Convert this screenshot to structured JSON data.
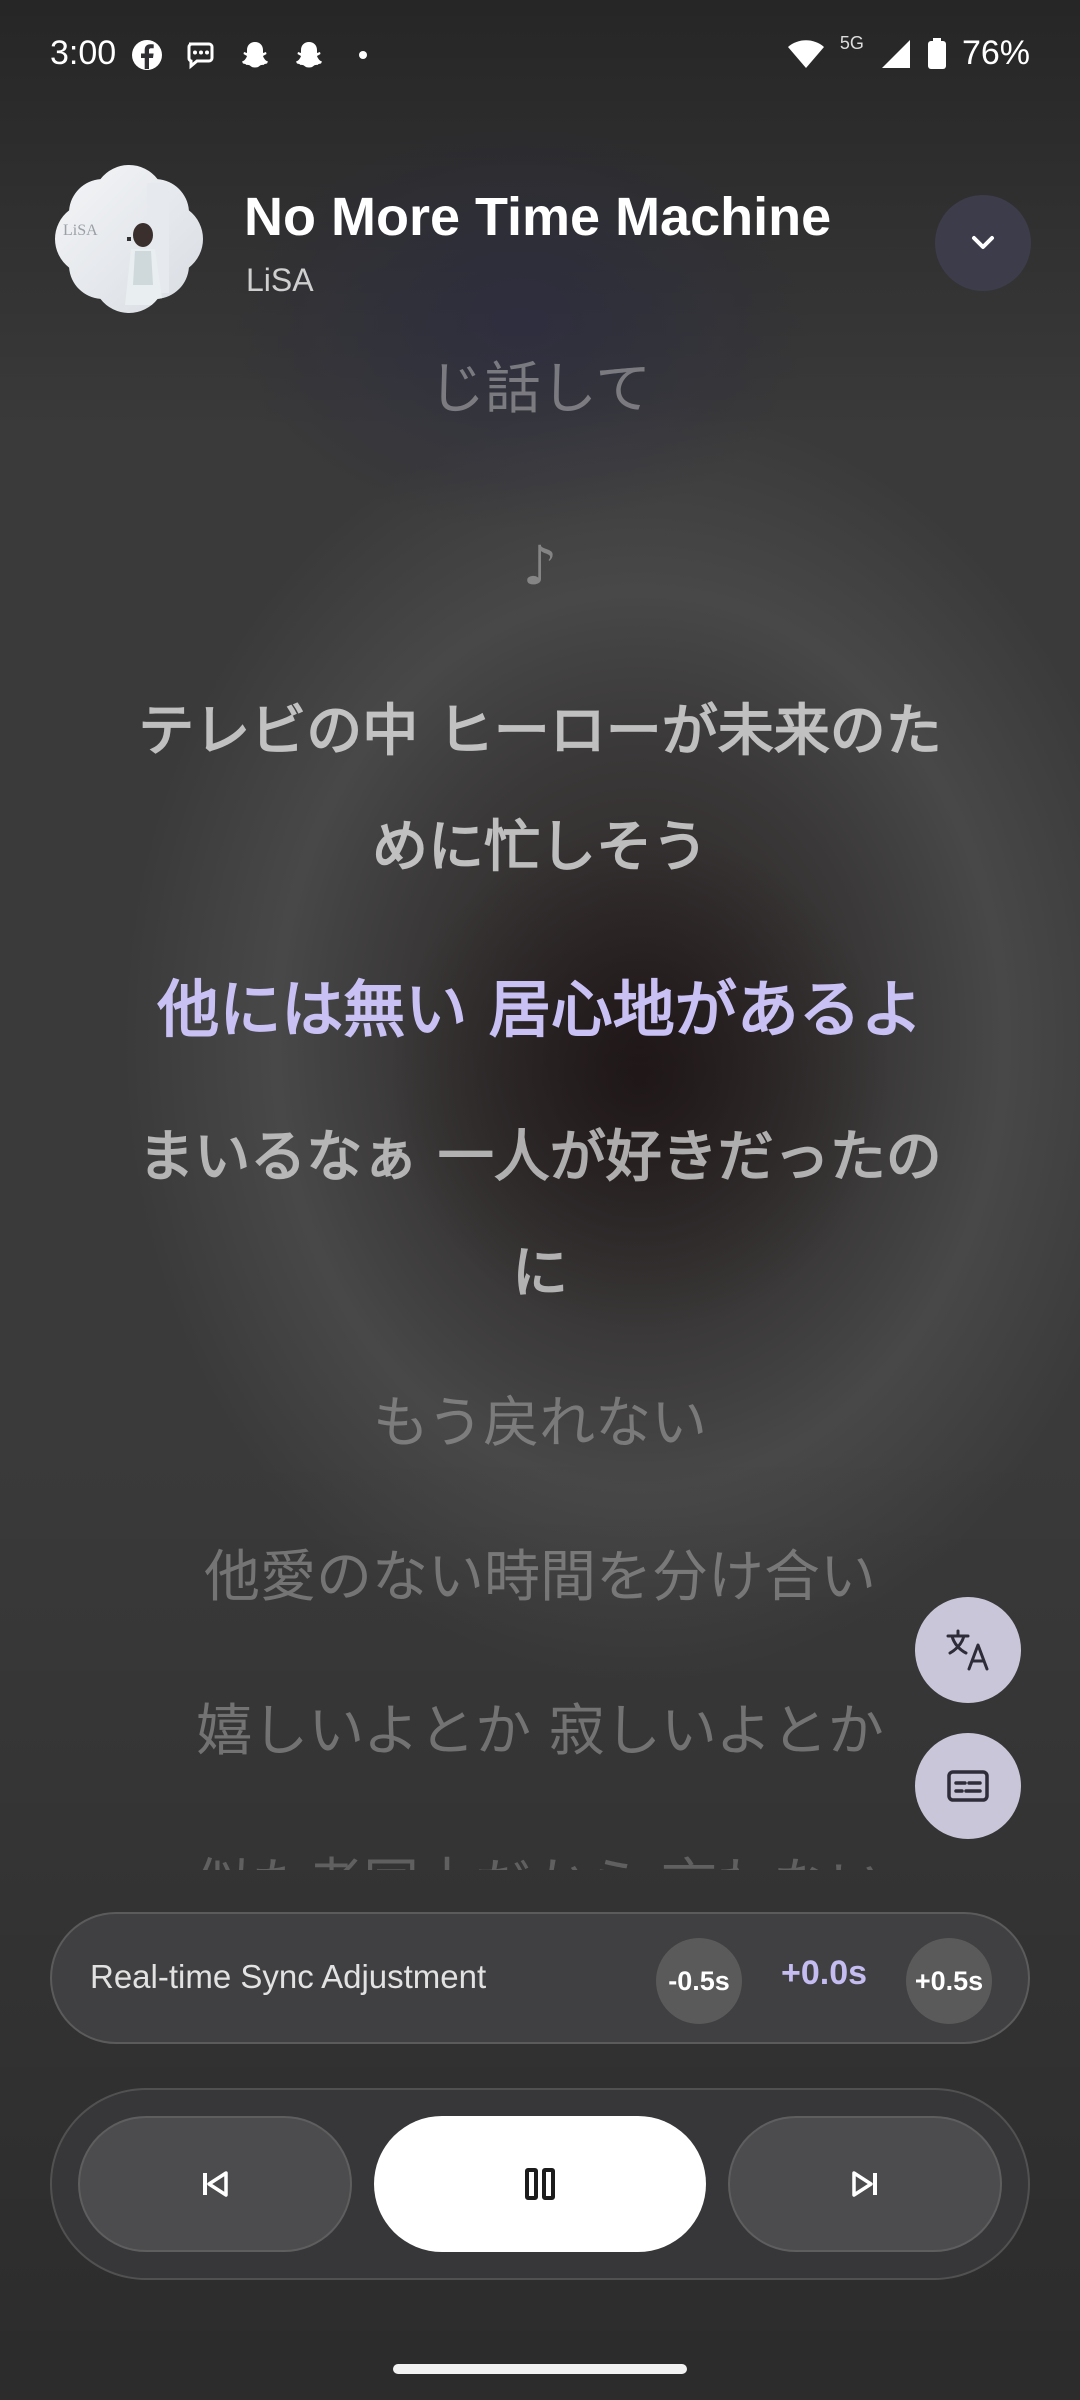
{
  "status_bar": {
    "time": "3:00",
    "left_icons": [
      "facebook-icon",
      "messenger-icon",
      "snapchat-icon",
      "snapchat-icon",
      "dot-icon"
    ],
    "network_label": "5G",
    "battery": "76%"
  },
  "track": {
    "title": "No More Time Machine",
    "artist": "LiSA",
    "album_art_text": "LiSA"
  },
  "lyrics": [
    {
      "text": "じ話して",
      "state": "faded"
    },
    {
      "text": "♪",
      "state": "faded"
    },
    {
      "text": "テレビの中 ヒーローが未来のた",
      "state": "near"
    },
    {
      "text": "めに忙しそう",
      "state": "near"
    },
    {
      "text": "他には無い 居心地があるよ",
      "state": "active"
    },
    {
      "text": "まいるなぁ 一人が好きだったの",
      "state": "next"
    },
    {
      "text": "に",
      "state": "next"
    },
    {
      "text": "もう戻れない",
      "state": "dim"
    },
    {
      "text": "他愛のない時間を分け合い",
      "state": "dim"
    },
    {
      "text": "嬉しいよとか 寂しいよとか",
      "state": "dim"
    },
    {
      "text": "似た者同士だから 言わない",
      "state": "cut"
    }
  ],
  "fabs": {
    "translate_icon": "translate-icon",
    "subtitles_icon": "subtitles-icon"
  },
  "sync": {
    "label": "Real-time Sync Adjustment",
    "minus": "-0.5s",
    "value": "+0.0s",
    "plus": "+0.5s"
  },
  "controls": {
    "prev_icon": "skip-previous-icon",
    "play_icon": "pause-icon",
    "next_icon": "skip-next-icon"
  },
  "colors": {
    "accent": "#c9c1f4",
    "fab_bg": "#c9c6d9"
  }
}
